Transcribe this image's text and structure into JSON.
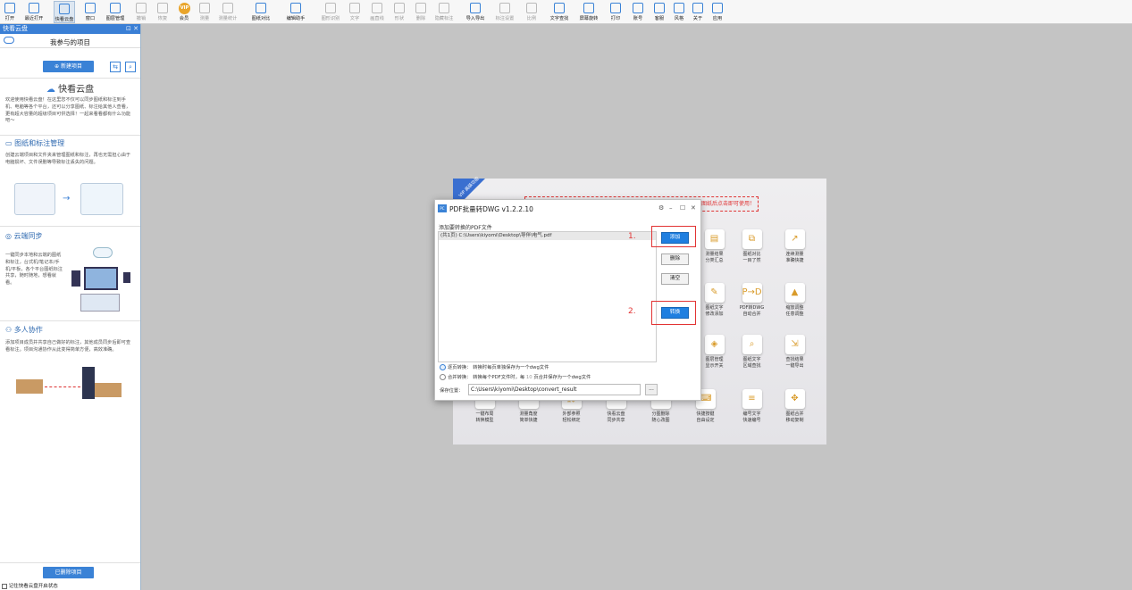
{
  "toolbar": {
    "items": [
      {
        "label": "打开",
        "icon": "folder-icon"
      },
      {
        "label": "最近打开",
        "icon": "recent-icon"
      },
      {
        "label": "快看云盘",
        "icon": "cloud-icon"
      },
      {
        "label": "窗口",
        "icon": "window-icon"
      },
      {
        "label": "图层管理",
        "icon": "layers-icon"
      },
      {
        "label": "撤销",
        "icon": "undo-icon"
      },
      {
        "label": "恢复",
        "icon": "redo-icon"
      },
      {
        "label": "会员",
        "icon": "vip-icon"
      },
      {
        "label": "测量",
        "icon": "measure-icon"
      },
      {
        "label": "测量统计",
        "icon": "measure-stats-icon"
      },
      {
        "label": "图纸对比",
        "icon": "compare-icon"
      },
      {
        "label": "编辑助手",
        "icon": "edit-helper-icon"
      },
      {
        "label": "图形识别",
        "icon": "recognize-icon"
      },
      {
        "label": "文字",
        "icon": "text-icon"
      },
      {
        "label": "画直线",
        "icon": "line-icon"
      },
      {
        "label": "形状",
        "icon": "shape-icon"
      },
      {
        "label": "删除",
        "icon": "erase-icon"
      },
      {
        "label": "隐藏标注",
        "icon": "hide-annotation-icon"
      },
      {
        "label": "导入导出",
        "icon": "import-export-icon"
      },
      {
        "label": "标注设置",
        "icon": "annotation-settings-icon"
      },
      {
        "label": "比例",
        "icon": "scale-icon"
      },
      {
        "label": "文字查找",
        "icon": "text-search-icon"
      },
      {
        "label": "屏幕旋转",
        "icon": "rotate-icon"
      },
      {
        "label": "打印",
        "icon": "print-icon"
      },
      {
        "label": "账号",
        "icon": "account-icon"
      },
      {
        "label": "客服",
        "icon": "support-icon"
      },
      {
        "label": "风格",
        "icon": "style-icon"
      },
      {
        "label": "关于",
        "icon": "about-icon"
      },
      {
        "label": "应用",
        "icon": "apps-icon"
      }
    ],
    "vip_text": "VIP"
  },
  "sidebar": {
    "title": "快看云盘",
    "window_buttons": "⊡ ✕",
    "project_tab": "我参与的项目",
    "new_project_button": "⊕ 新建项目",
    "sync_icon": "⇆",
    "search_icon": "⌕",
    "cloud_heading": "快看云盘",
    "intro": "欢迎使用快看云盘！在这里您不仅可以同步图纸和标注到手机、电脑等各个平台，还可以分享图纸、标注给其他人查看，更有超大容量的超级项目可供选择！一起来看看都有什么功能吧～",
    "section1_title": "图纸和标注管理",
    "section1_text": "创建云端项目和文件夹来管理图纸和标注，再也无需担心由于电脑损坏、文件误删等导致标注丢失的问题。",
    "section2_title": "云端同步",
    "section2_text": "一键同步本地和云端的图纸和标注，台式机/笔记本/手机/平板，各个平台图纸标注共享，随时随地，想看就看。",
    "section3_title": "多人协作",
    "section3_text": "添加项目成员并共享自己做好的标注，其他成员同步后即可查看标注。项目沟通协作从此变得简单方便，高效准确。",
    "illustration_caption": "云端同步",
    "deleted_projects_button": "已删除项目",
    "remember_checkbox": "记住快看云盘开启状态"
  },
  "promo": {
    "vip_badge": "VIP 高级功能",
    "notice": "VIP会员开通后,点击图纸后说图纸后点击即可使用！",
    "items": [
      {
        "label": "测量结果\n分类汇总",
        "glyph": "▤"
      },
      {
        "label": "图纸对比\n一目了然",
        "glyph": "⧉"
      },
      {
        "label": "连续测量\n准确快捷",
        "glyph": "↗"
      },
      {
        "label": "图纸文字\n修改添加",
        "glyph": "✎"
      },
      {
        "label": "PDF转DWG\n自动合并",
        "glyph": "P→D"
      },
      {
        "label": "缩放调整\n任意调整",
        "glyph": "▲"
      },
      {
        "label": "图层管理\n显示开关",
        "glyph": "◈"
      },
      {
        "label": "图纸文字\n区域查找",
        "glyph": "⌕"
      },
      {
        "label": "查找结果\n一键导出",
        "glyph": "⇲"
      },
      {
        "label": "一键布局\n转换模型",
        "glyph": "▭"
      },
      {
        "label": "测量角度\n简单快捷",
        "glyph": "∠"
      },
      {
        "label": "外部参照\n轻松绑定",
        "glyph": "⛓"
      },
      {
        "label": "快看云盘\n同步共享",
        "glyph": "☁"
      },
      {
        "label": "分图删除\n随心改图",
        "glyph": "✂"
      },
      {
        "label": "快捷按键\n自由设定",
        "glyph": "⌨"
      },
      {
        "label": "编号文字\n快速编号",
        "glyph": "≡"
      },
      {
        "label": "图纸合并\n移动复制",
        "glyph": "✥"
      }
    ]
  },
  "dialog": {
    "logo": "PC",
    "title": "PDF批量转DWG v1.2.2.10",
    "window_controls": {
      "settings": "⚙",
      "minimize": "–",
      "maximize": "☐",
      "close": "✕"
    },
    "list_label": "添加要转换的PDF文件",
    "files": [
      "(共1页) C:\\Users\\kiyomi\\Desktop\\导伴\\电气.pdf"
    ],
    "add_button": "添加",
    "delete_button": "删除",
    "clear_button": "清空",
    "convert_button": "转换",
    "step1": "1.",
    "step2": "2.",
    "option1_label": "逐页转换：",
    "option1_text": "转换时每页单独保存为一个dwg文件",
    "option2_label": "合并转换：",
    "option2_text": "转换每个PDF文件时，每",
    "option2_value": "10",
    "option2_suffix": "页合并保存为一个dwg文件",
    "save_label": "保存位置：",
    "save_path": "C:\\Users\\kiyomi\\Desktop\\convert_result",
    "browse": "..."
  },
  "colors": {
    "accent": "#3a82d6",
    "highlight": "#e23333",
    "primary_button": "#1f7fe0"
  }
}
